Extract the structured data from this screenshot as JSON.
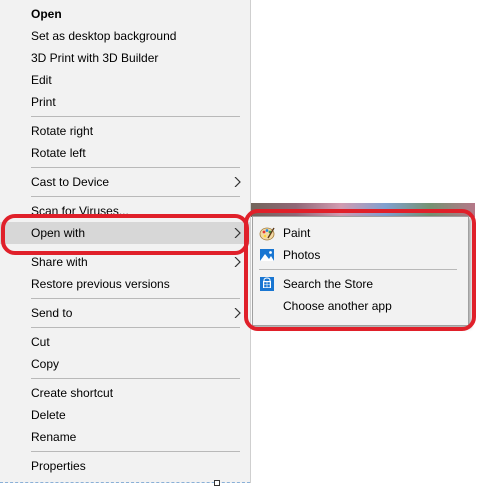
{
  "context_menu": {
    "items": [
      {
        "label": "Open"
      },
      {
        "label": "Set as desktop background"
      },
      {
        "label": "3D Print with 3D Builder"
      },
      {
        "label": "Edit"
      },
      {
        "label": "Print"
      },
      {
        "label": "Rotate right"
      },
      {
        "label": "Rotate left"
      },
      {
        "label": "Cast to Device"
      },
      {
        "label": "Scan for Viruses..."
      },
      {
        "label": "Open with"
      },
      {
        "label": "Share with"
      },
      {
        "label": "Restore previous versions"
      },
      {
        "label": "Send to"
      },
      {
        "label": "Cut"
      },
      {
        "label": "Copy"
      },
      {
        "label": "Create shortcut"
      },
      {
        "label": "Delete"
      },
      {
        "label": "Rename"
      },
      {
        "label": "Properties"
      }
    ]
  },
  "open_with_submenu": {
    "items": [
      {
        "label": "Paint",
        "icon": "paint-icon"
      },
      {
        "label": "Photos",
        "icon": "photos-icon"
      },
      {
        "label": "Search the Store",
        "icon": "store-icon"
      },
      {
        "label": "Choose another app"
      }
    ]
  },
  "colors": {
    "menu_background": "#f2f2f2",
    "hover_background": "#d7d7d7",
    "annotation_red": "#e0202a"
  }
}
